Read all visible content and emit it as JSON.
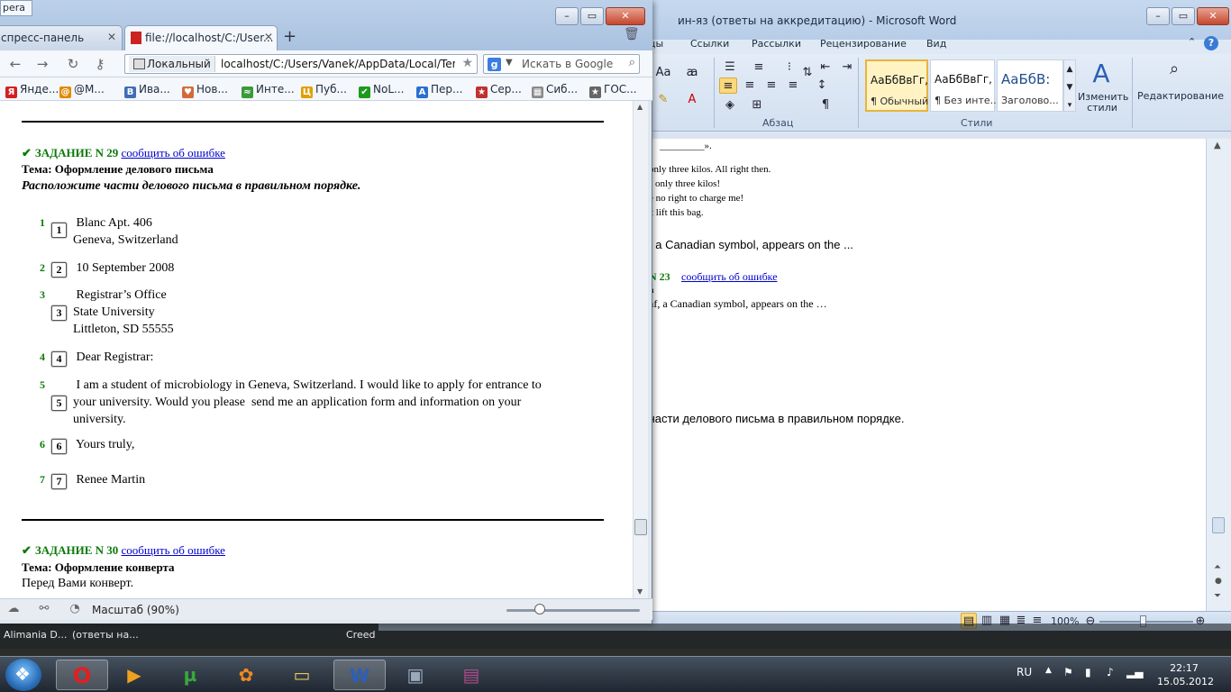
{
  "word": {
    "title": "ин-яз (ответы на аккредитацию)  -  Microsoft Word",
    "menu": [
      "цы",
      "Ссылки",
      "Рассылки",
      "Рецензирование",
      "Вид"
    ],
    "styles": [
      {
        "sample": "АаБбВвГг,",
        "name": "¶ Обычный"
      },
      {
        "sample": "АаБбВвГг,",
        "name": "¶ Без инте..."
      },
      {
        "sample": "АаБбВ:",
        "name": "Заголово..."
      }
    ],
    "change_styles": "Изменить стили",
    "editing": "Редактирование",
    "group_paragraph": "Абзац",
    "group_styles": "Стили",
    "doc_lines": [
      "_________».",
      "only three kilos. All right then.",
      "s only three kilos!",
      "e no right to charge me!",
      "'t lift this bag.",
      ", a Canadian symbol, appears on the ..."
    ],
    "task23_num": "N 23",
    "task23_link": "сообщить об ошибке",
    "doc_line_a": "а",
    "doc_line_maple": "af, a Canadian symbol, appears on the …",
    "doc_line_r": "r",
    "doc_line_last": "части делового письма в правильном порядке.",
    "zoom": "100%"
  },
  "opera": {
    "corner_tab": "pera",
    "tabs": [
      {
        "label": "спресс-панель"
      },
      {
        "label": "file://localhost/C:/User..."
      }
    ],
    "address_site": "Локальный",
    "address_url": "localhost/C:/Users/Vanek/AppData/Local/Temp/I",
    "search_placeholder": "Искать в Google",
    "bookmarks": [
      {
        "label": "Янде...",
        "icon": "Я",
        "color": "#d32020"
      },
      {
        "label": "@M...",
        "icon": "@",
        "color": "#e08a00"
      },
      {
        "label": "Ива...",
        "icon": "B",
        "color": "#3f6fb5"
      },
      {
        "label": "Нов...",
        "icon": "♥",
        "color": "#d26a3a"
      },
      {
        "label": "Инте...",
        "icon": "≈",
        "color": "#3a9a3a"
      },
      {
        "label": "Пуб...",
        "icon": "Ц",
        "color": "#e0a000"
      },
      {
        "label": "NoL...",
        "icon": "✔",
        "color": "#1c9a1c"
      },
      {
        "label": "Пер...",
        "icon": "A",
        "color": "#2b6fcf"
      },
      {
        "label": "Сер...",
        "icon": "★",
        "color": "#c03030"
      },
      {
        "label": "Сиб...",
        "icon": "▦",
        "color": "#8a8a8a"
      },
      {
        "label": "ГОС...",
        "icon": "★",
        "color": "#666"
      }
    ],
    "zoom_label": "Масштаб (90%)"
  },
  "content": {
    "task29_label": "ЗАДАНИЕ N 29",
    "report_link": "сообщить об ошибке",
    "task29_topic": "Тема: Оформление делового письма",
    "task29_instruction": "Расположите части делового письма в правильном порядке.",
    "parts": [
      {
        "num": "1",
        "box": "1",
        "lines": [
          " Blanc Apt. 406",
          "Geneva, Switzerland"
        ]
      },
      {
        "num": "2",
        "box": "2",
        "lines": [
          " 10 September 2008"
        ]
      },
      {
        "num": "3",
        "box": "3",
        "lines": [
          " Registrar’s Office",
          "State University",
          "Littleton, SD 55555"
        ]
      },
      {
        "num": "4",
        "box": "4",
        "lines": [
          " Dear Registrar:"
        ]
      },
      {
        "num": "5",
        "box": "5",
        "lines": [
          " I am a student of microbiology in Geneva, Switzerland. I would like to apply for entrance to",
          "your university. Would you please  send me an application form and information on your",
          "university."
        ]
      },
      {
        "num": "6",
        "box": "6",
        "lines": [
          " Yours truly,"
        ]
      },
      {
        "num": "7",
        "box": "7",
        "lines": [
          " Renee Martin"
        ]
      }
    ],
    "task30_label": "ЗАДАНИЕ N 30",
    "task30_topic": "Тема: Оформление конверта",
    "task30_text": "Перед Вами конверт."
  },
  "taskbar": {
    "top_items": [
      "Alimania D...",
      "(ответы на...",
      "Creed"
    ],
    "language": "RU",
    "time": "22:17",
    "date": "15.05.2012"
  }
}
